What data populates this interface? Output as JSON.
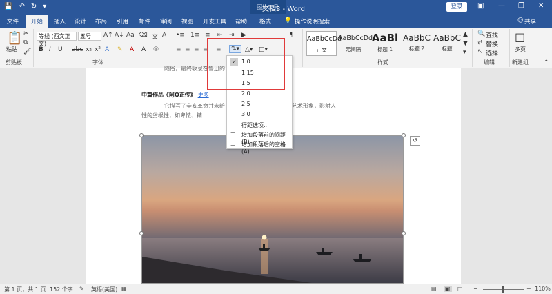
{
  "window": {
    "title": "文档3 - Word",
    "contextual_group": "图片工具",
    "login_label": "登录"
  },
  "tabs": [
    "文件",
    "开始",
    "插入",
    "设计",
    "布局",
    "引用",
    "邮件",
    "审阅",
    "视图",
    "开发工具",
    "帮助",
    "格式"
  ],
  "tell_me": "操作说明搜索",
  "share_label": "共享",
  "ribbon": {
    "paste_label": "粘贴",
    "font_name": "等线 (西文正文)",
    "font_size": "五号",
    "styles": [
      {
        "preview": "AaBbCcDd",
        "label": "正文"
      },
      {
        "preview": "AaBbCcDd",
        "label": "无间隔"
      },
      {
        "preview": "AaBl",
        "label": "标题 1"
      },
      {
        "preview": "AaBbC",
        "label": "标题 2"
      },
      {
        "preview": "AaBbC",
        "label": "标题"
      }
    ],
    "find_label": "查找",
    "replace_label": "替换",
    "select_label": "选择",
    "multipage_label": "多页",
    "groups": {
      "clipboard": "剪贴板",
      "font": "字体",
      "styles": "样式",
      "editing": "编辑",
      "newgroup": "新建组"
    }
  },
  "document": {
    "line1": "随俗，最终收录在鲁迅的",
    "heading": "中篇作品《阿Q正传》",
    "heading_link": "更多",
    "body1": "它描写了辛亥革命并未给                          通过农村中贫穷雇农阿Q的艺术形象，影射人",
    "body2": "性的劣根性，如卑怯、精"
  },
  "line_spacing_menu": {
    "options": [
      "1.0",
      "1.15",
      "1.5",
      "2.0",
      "2.5",
      "3.0"
    ],
    "checked": "1.0",
    "more": "行距选项...",
    "add_before": "增加段落前的间距(B)",
    "add_after": "增加段落后的空格(A)"
  },
  "status": {
    "page": "第 1 页，共 1 页",
    "words": "152 个字",
    "language": "英语(美国)",
    "zoom": "110%"
  }
}
